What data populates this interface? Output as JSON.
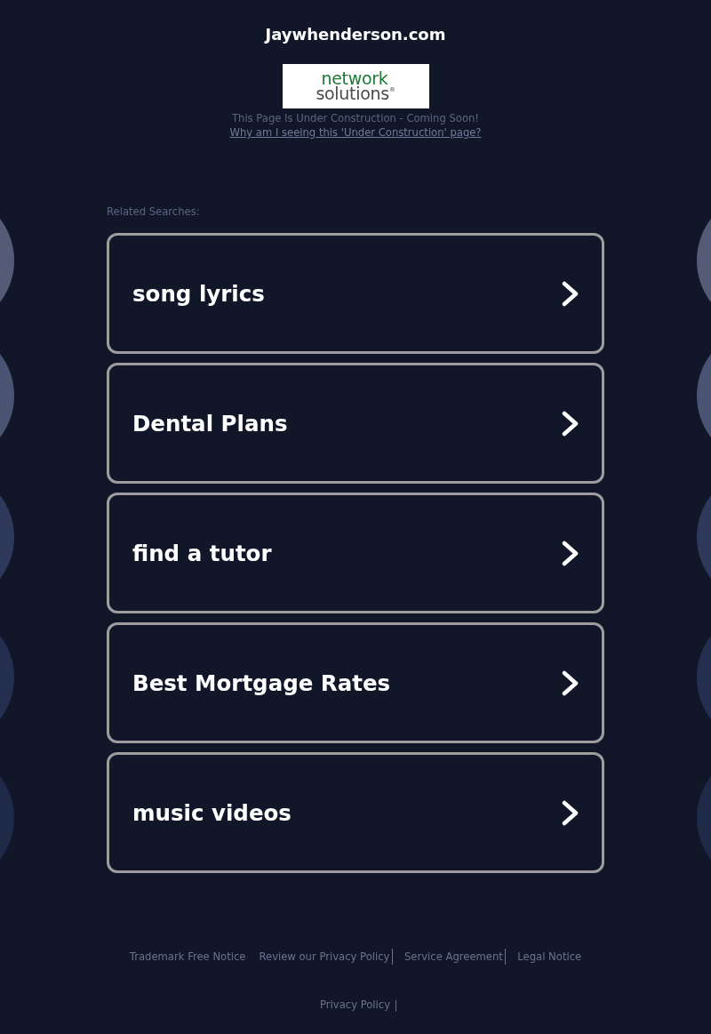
{
  "header": {
    "title": "Jaywhenderson.com"
  },
  "logo": {
    "line_1": "network",
    "line_2": "solutions$^{®}$"
  },
  "notice": {
    "message": "This Page Is Under Construction - Coming Soon!",
    "link": "Why am I seeing this 'Under Construction' page?"
  },
  "related": {
    "heading": "Related Searches:",
    "items": [
      {
        "label": "song lyrics"
      },
      {
        "label": "Dental Plans"
      },
      {
        "label": "find a tutor"
      },
      {
        "label": "Best Mortgage Rates"
      },
      {
        "label": "music videos"
      }
    ]
  },
  "footer": {
    "links": [
      {
        "label": "Trademark Free Notice",
        "divider_before": false
      },
      {
        "label": "Review our Privacy Policy",
        "divider_before": false
      },
      {
        "label": "Service Agreement",
        "divider_before": true
      },
      {
        "label": "Legal Notice",
        "divider_before": true
      }
    ],
    "privacy_link": "Privacy Policy",
    "separator": "|"
  }
}
